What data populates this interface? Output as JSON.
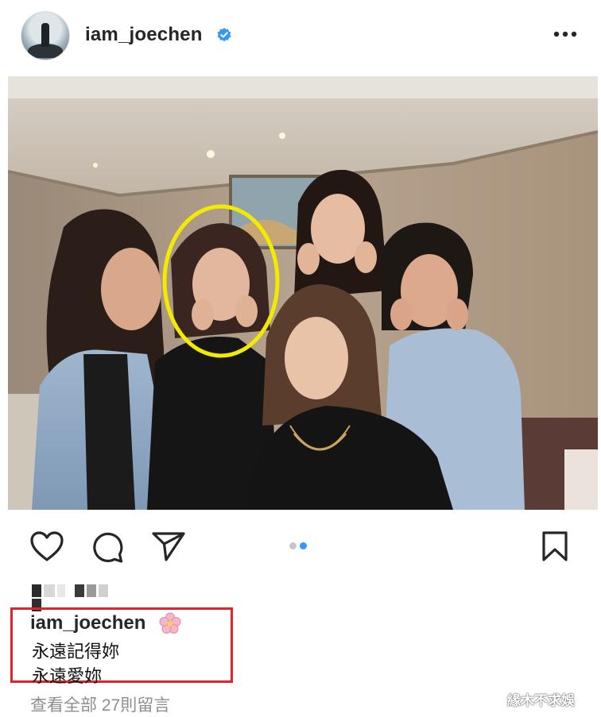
{
  "header": {
    "username": "iam_joechen",
    "verified": true,
    "more_icon": "more-horizontal-icon"
  },
  "post": {
    "photo_icon": "group-photo",
    "highlight_color": "#f2ea00",
    "carousel": {
      "count": 2,
      "active_index": 1
    }
  },
  "actions": {
    "like_icon": "heart-icon",
    "comment_icon": "comment-icon",
    "share_icon": "send-icon",
    "save_icon": "bookmark-icon"
  },
  "caption": {
    "username": "iam_joechen",
    "emoji_icon": "cherry-blossom-icon",
    "lines": [
      "永遠記得妳",
      "永遠愛妳"
    ],
    "highlight_box_color": "#e8202a"
  },
  "comments": {
    "view_all_label": "查看全部 27則留言"
  },
  "watermark": "緣木不求娛"
}
